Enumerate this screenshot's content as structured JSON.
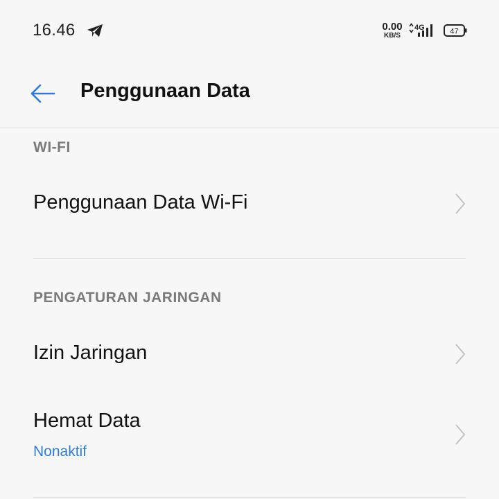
{
  "status_bar": {
    "time": "16.46",
    "net_speed_value": "0.00",
    "net_speed_unit": "KB/S",
    "network_type": "4G",
    "battery_level": "47"
  },
  "app_bar": {
    "title": "Penggunaan Data",
    "back_icon": "arrow-left-icon"
  },
  "sections": {
    "wifi": {
      "header": "WI-FI",
      "items": [
        {
          "title": "Penggunaan Data Wi-Fi"
        }
      ]
    },
    "network": {
      "header": "PENGATURAN JARINGAN",
      "items": [
        {
          "title": "Izin Jaringan"
        },
        {
          "title": "Hemat Data",
          "subtitle": "Nonaktif"
        }
      ]
    }
  },
  "colors": {
    "accent": "#2f7bd8",
    "background": "#f7f7f7",
    "section_header": "#7a7a7a",
    "divider": "#e3e3e3"
  }
}
